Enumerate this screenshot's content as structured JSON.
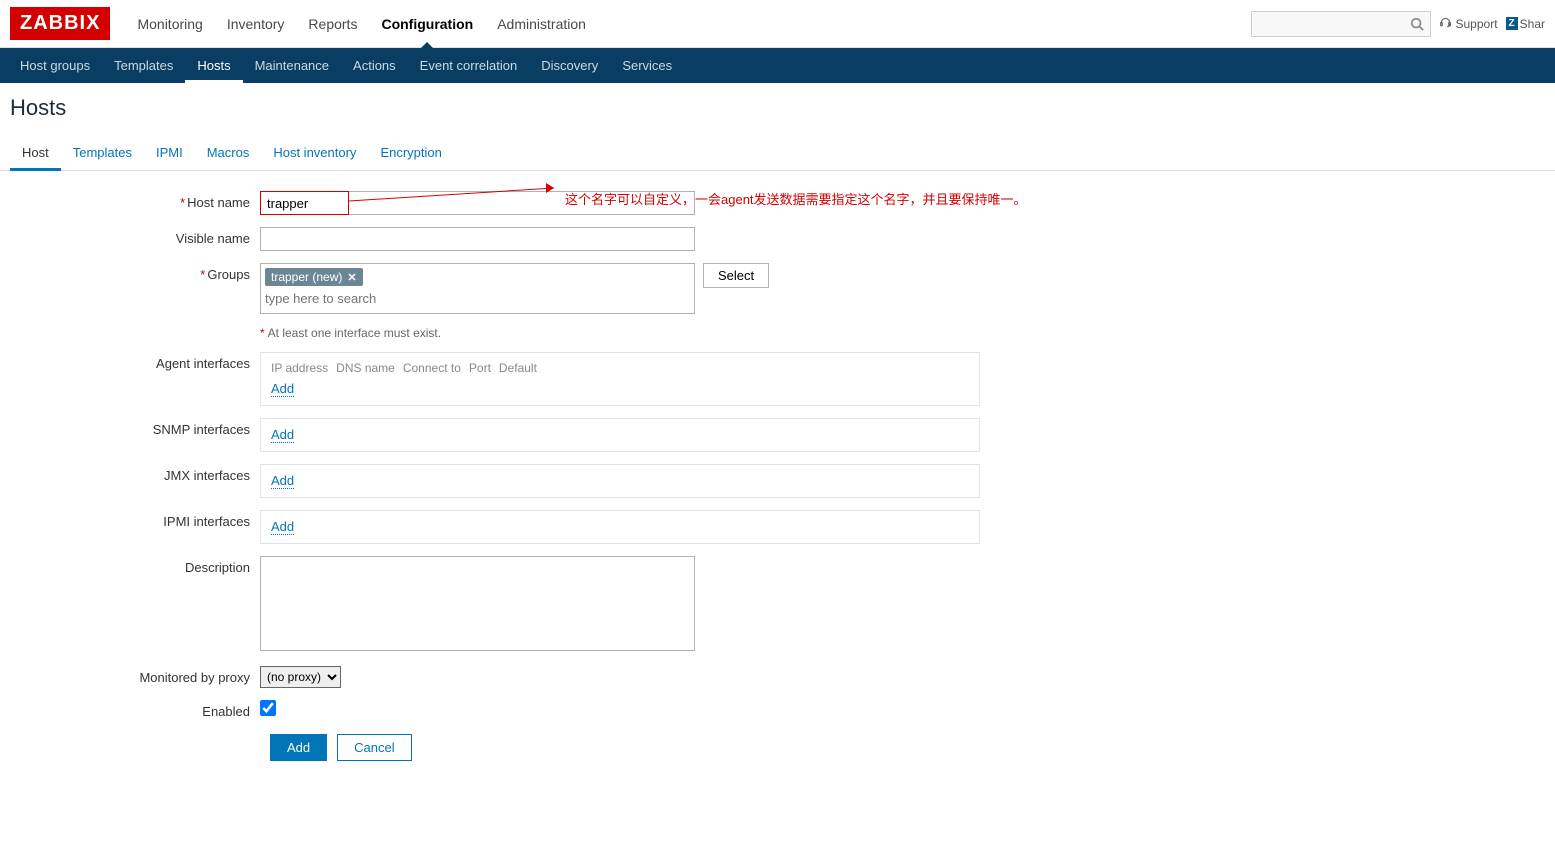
{
  "brand": "ZABBIX",
  "topnav": {
    "items": [
      "Monitoring",
      "Inventory",
      "Reports",
      "Configuration",
      "Administration"
    ],
    "active": "Configuration",
    "support": "Support",
    "share": "Shar"
  },
  "subnav": {
    "items": [
      "Host groups",
      "Templates",
      "Hosts",
      "Maintenance",
      "Actions",
      "Event correlation",
      "Discovery",
      "Services"
    ],
    "active": "Hosts"
  },
  "page": {
    "title": "Hosts"
  },
  "tabs": {
    "items": [
      "Host",
      "Templates",
      "IPMI",
      "Macros",
      "Host inventory",
      "Encryption"
    ],
    "active": "Host"
  },
  "form": {
    "host_name_label": "Host name",
    "host_name_value": "trapper",
    "visible_name_label": "Visible name",
    "visible_name_value": "",
    "groups_label": "Groups",
    "groups_tag": "trapper (new)",
    "groups_placeholder": "type here to search",
    "select_btn": "Select",
    "hint": "At least one interface must exist.",
    "agent_if_label": "Agent interfaces",
    "iface_cols": {
      "ip": "IP address",
      "dns": "DNS name",
      "connect": "Connect to",
      "port": "Port",
      "default": "Default"
    },
    "add_link": "Add",
    "snmp_if_label": "SNMP interfaces",
    "jmx_if_label": "JMX interfaces",
    "ipmi_if_label": "IPMI interfaces",
    "description_label": "Description",
    "description_value": "",
    "proxy_label": "Monitored by proxy",
    "proxy_value": "(no proxy)",
    "enabled_label": "Enabled",
    "enabled_checked": true,
    "add_btn": "Add",
    "cancel_btn": "Cancel"
  },
  "annotation": "这个名字可以自定义，一会agent发送数据需要指定这个名字，并且要保持唯一。"
}
